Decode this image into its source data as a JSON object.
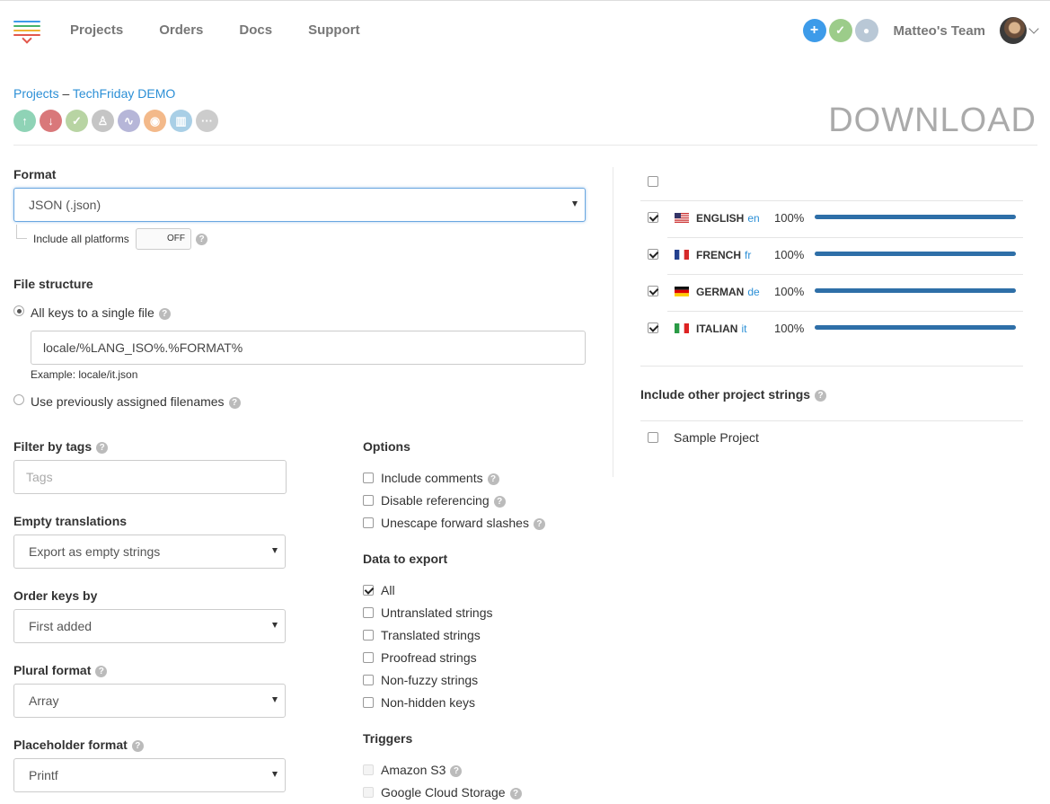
{
  "nav": {
    "projects": "Projects",
    "orders": "Orders",
    "docs": "Docs",
    "support": "Support"
  },
  "team": {
    "name": "Matteo's Team"
  },
  "breadcrumb": {
    "root": "Projects",
    "separator": " – ",
    "project": "TechFriday DEMO"
  },
  "page_title": "DOWNLOAD",
  "format": {
    "label": "Format",
    "value": "JSON (.json)",
    "include_platforms_label": "Include all platforms",
    "toggle_state": "OFF"
  },
  "file_structure": {
    "label": "File structure",
    "option_single": "All keys to a single file",
    "path_value": "locale/%LANG_ISO%.%FORMAT%",
    "example": "Example: locale/it.json",
    "option_previous": "Use previously assigned filenames"
  },
  "filter_tags": {
    "label": "Filter by tags",
    "placeholder": "Tags"
  },
  "empty_translations": {
    "label": "Empty translations",
    "value": "Export as empty strings"
  },
  "order_keys": {
    "label": "Order keys by",
    "value": "First added"
  },
  "plural_format": {
    "label": "Plural format",
    "value": "Array"
  },
  "placeholder_format": {
    "label": "Placeholder format",
    "value": "Printf"
  },
  "options": {
    "label": "Options",
    "items": [
      {
        "label": "Include comments",
        "checked": false
      },
      {
        "label": "Disable referencing",
        "checked": false
      },
      {
        "label": "Unescape forward slashes",
        "checked": false
      }
    ]
  },
  "data_to_export": {
    "label": "Data to export",
    "items": [
      {
        "label": "All",
        "checked": true
      },
      {
        "label": "Untranslated strings",
        "checked": false
      },
      {
        "label": "Translated strings",
        "checked": false
      },
      {
        "label": "Proofread strings",
        "checked": false
      },
      {
        "label": "Non-fuzzy strings",
        "checked": false
      },
      {
        "label": "Non-hidden keys",
        "checked": false
      }
    ]
  },
  "triggers": {
    "label": "Triggers",
    "items": [
      {
        "label": "Amazon S3"
      },
      {
        "label": "Google Cloud Storage"
      }
    ]
  },
  "languages": [
    {
      "name": "ENGLISH",
      "code": "en",
      "percent": "100%",
      "progress": 1.0,
      "checked": true
    },
    {
      "name": "FRENCH",
      "code": "fr",
      "percent": "100%",
      "progress": 1.0,
      "checked": true
    },
    {
      "name": "GERMAN",
      "code": "de",
      "percent": "100%",
      "progress": 1.0,
      "checked": true
    },
    {
      "name": "ITALIAN",
      "code": "it",
      "percent": "100%",
      "progress": 1.0,
      "checked": true
    }
  ],
  "other_projects": {
    "label": "Include other project strings",
    "items": [
      {
        "label": "Sample Project",
        "checked": false
      }
    ]
  },
  "help_glyph": "?",
  "colors": {
    "link": "#2b8fd6",
    "progress": "#2e6fa8",
    "heading_gray": "#aaaaaa"
  }
}
